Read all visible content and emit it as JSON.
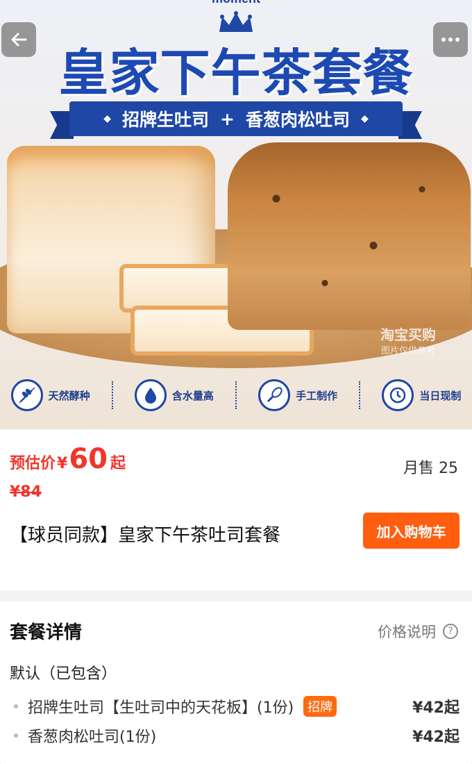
{
  "hero": {
    "brand_text": "moment",
    "big_title": "皇家下午茶套餐",
    "ribbon_left": "招牌生吐司",
    "ribbon_plus": "+",
    "ribbon_right": "香葱肉松吐司",
    "watermark": "淘宝买购",
    "watermark_sub": "图片仅供参考",
    "features": [
      {
        "label": "天然酵种",
        "icon": "wheat-icon"
      },
      {
        "label": "含水量高",
        "icon": "water-drop-icon"
      },
      {
        "label": "手工制作",
        "icon": "whisk-icon"
      },
      {
        "label": "当日现制",
        "icon": "clock-icon"
      }
    ]
  },
  "nav": {
    "back_icon": "back-arrow-icon",
    "more_icon": "more-dots-icon"
  },
  "product": {
    "price_label": "预估价",
    "price_currency": "¥",
    "price_value": "60",
    "price_suffix": "起",
    "original_price": "¥84",
    "monthly_sales": "月售 25",
    "title": "【球员同款】皇家下午茶吐司套餐",
    "add_to_cart": "加入购物车"
  },
  "package": {
    "section_title": "套餐详情",
    "price_note": "价格说明",
    "group_title": "默认（已包含）",
    "items": [
      {
        "name": "招牌生吐司【生吐司中的天花板】(1份)",
        "tag": "招牌",
        "price": "¥42起"
      },
      {
        "name": "香葱肉松吐司(1份)",
        "tag": "",
        "price": "¥42起"
      }
    ]
  },
  "colors": {
    "price_red": "#f3342a",
    "cart_orange": "#ff5e0e",
    "brand_blue": "#1e47a6"
  }
}
